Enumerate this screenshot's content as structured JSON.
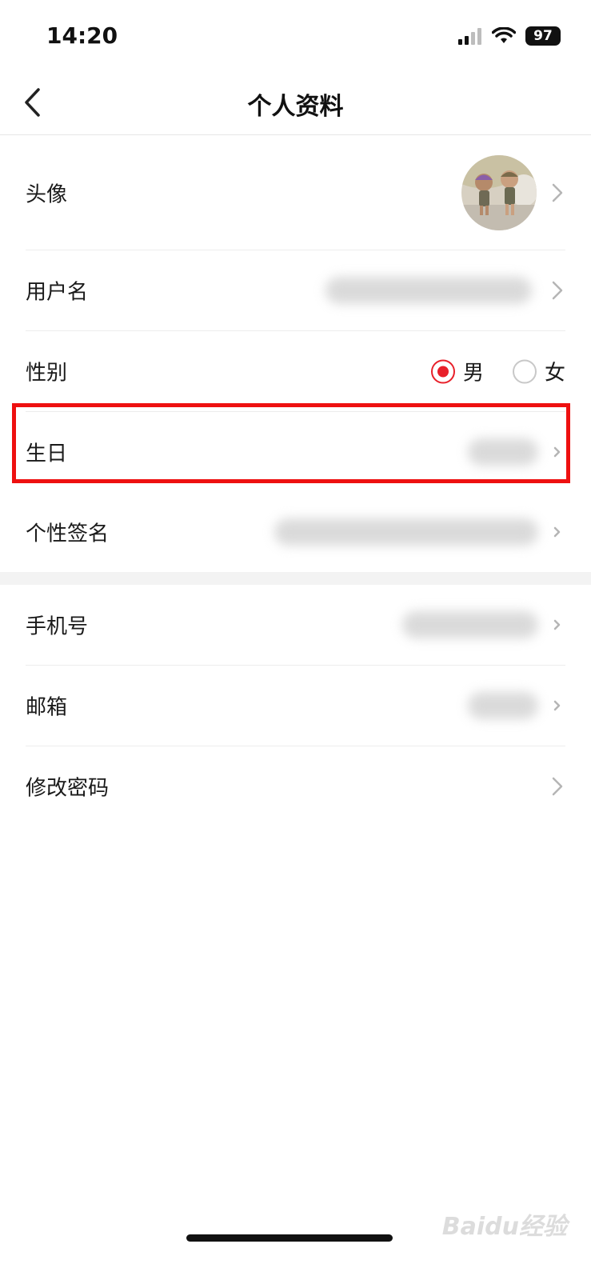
{
  "status_bar": {
    "time": "14:20",
    "battery": "97"
  },
  "nav": {
    "title": "个人资料"
  },
  "rows": {
    "avatar": {
      "label": "头像"
    },
    "username": {
      "label": "用户名"
    },
    "gender": {
      "label": "性别",
      "options": [
        {
          "label": "男",
          "selected": true
        },
        {
          "label": "女",
          "selected": false
        }
      ]
    },
    "birthday": {
      "label": "生日"
    },
    "signature": {
      "label": "个性签名"
    },
    "phone": {
      "label": "手机号"
    },
    "email": {
      "label": "邮箱"
    },
    "password": {
      "label": "修改密码"
    }
  },
  "watermark": "Baidu经验",
  "colors": {
    "accent": "#e8202a",
    "highlight": "#ee1010"
  }
}
